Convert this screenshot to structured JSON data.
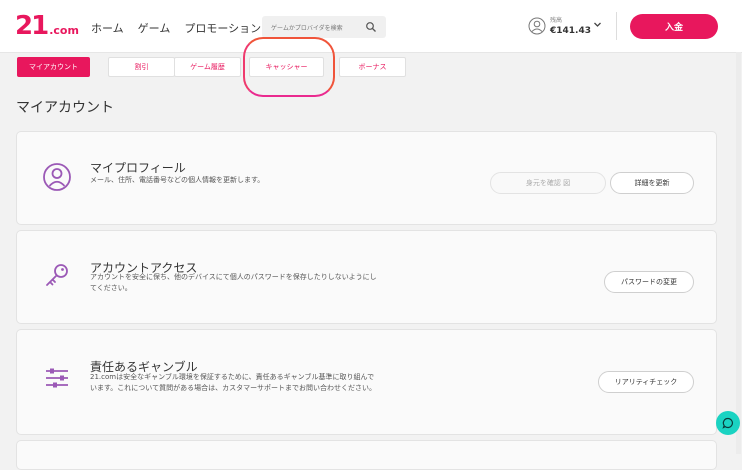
{
  "header": {
    "logo_main": "21",
    "logo_suffix": ".com",
    "nav": [
      "ホーム",
      "ゲーム",
      "プロモーション"
    ],
    "search_placeholder": "ゲームかプロバイダを検索",
    "balance_label": "残高",
    "balance_value": "€141.43",
    "deposit_label": "入金"
  },
  "tabs": [
    "マイアカウント",
    "割引",
    "ゲーム履歴",
    "キャッシャー",
    "ボーナス"
  ],
  "active_tab": "マイアカウント",
  "page_title": "マイアカウント",
  "cards": [
    {
      "title": "マイプロフィール",
      "desc": "メール、住所、電話番号などの個人情報を更新します。",
      "buttons": [
        "身元を確認 図",
        "詳細を更新"
      ],
      "icon": "user-icon"
    },
    {
      "title": "アカウントアクセス",
      "desc": "アカウントを安全に保ち、他のデバイスにて個人のパスワードを保存したりしないようにしてください。",
      "buttons": [
        "パスワードの変更"
      ],
      "icon": "key-icon"
    },
    {
      "title": "責任あるギャンブル",
      "desc": "21.comは安全なギャンブル環境を保証するために、責任あるギャンブル基準に取り組んでいます。これについて質問がある場合は、カスタマーサポートまでお問い合わせください。",
      "buttons": [
        "リアリティチェック"
      ],
      "icon": "sliders-icon"
    }
  ],
  "colors": {
    "brand": "#e8175d",
    "chat": "#1ad3c2",
    "annotation": "#f0543a"
  }
}
